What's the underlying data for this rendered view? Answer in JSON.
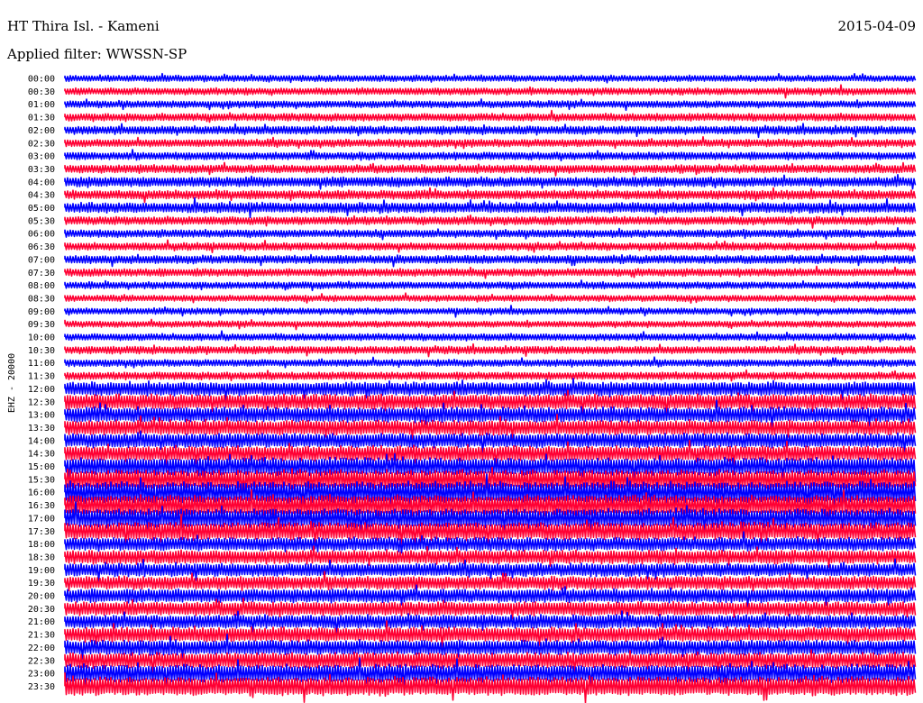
{
  "header": {
    "station": "HT Thira Isl. - Kameni",
    "date": "2015-04-09",
    "filter": "Applied filter: WWSSN-SP"
  },
  "chart_data": {
    "type": "helicorder",
    "ylabel": "EHZ - 20000",
    "row_labels": [
      "00:00",
      "00:30",
      "01:00",
      "01:30",
      "02:00",
      "02:30",
      "03:00",
      "03:30",
      "04:00",
      "04:30",
      "05:00",
      "05:30",
      "06:00",
      "06:30",
      "07:00",
      "07:30",
      "08:00",
      "08:30",
      "09:00",
      "09:30",
      "10:00",
      "10:30",
      "11:00",
      "11:30",
      "12:00",
      "12:30",
      "13:00",
      "13:30",
      "14:00",
      "14:30",
      "15:00",
      "15:30",
      "16:00",
      "16:30",
      "17:00",
      "17:30",
      "18:00",
      "18:30",
      "19:00",
      "19:30",
      "20:00",
      "20:30",
      "21:00",
      "21:30",
      "22:00",
      "22:30",
      "23:00",
      "23:30"
    ],
    "trace_colors": [
      "#0000ff",
      "#ff0033"
    ],
    "row_amplitude": [
      0.45,
      0.5,
      0.5,
      0.55,
      0.6,
      0.55,
      0.55,
      0.6,
      0.7,
      0.65,
      0.75,
      0.6,
      0.55,
      0.55,
      0.6,
      0.55,
      0.5,
      0.45,
      0.45,
      0.45,
      0.5,
      0.55,
      0.5,
      0.55,
      1.0,
      1.1,
      1.1,
      1.1,
      1.05,
      1.1,
      1.3,
      1.4,
      1.6,
      1.5,
      1.4,
      1.3,
      1.0,
      1.0,
      0.95,
      0.95,
      1.0,
      1.0,
      1.0,
      1.05,
      1.1,
      1.15,
      1.3,
      1.4
    ]
  }
}
